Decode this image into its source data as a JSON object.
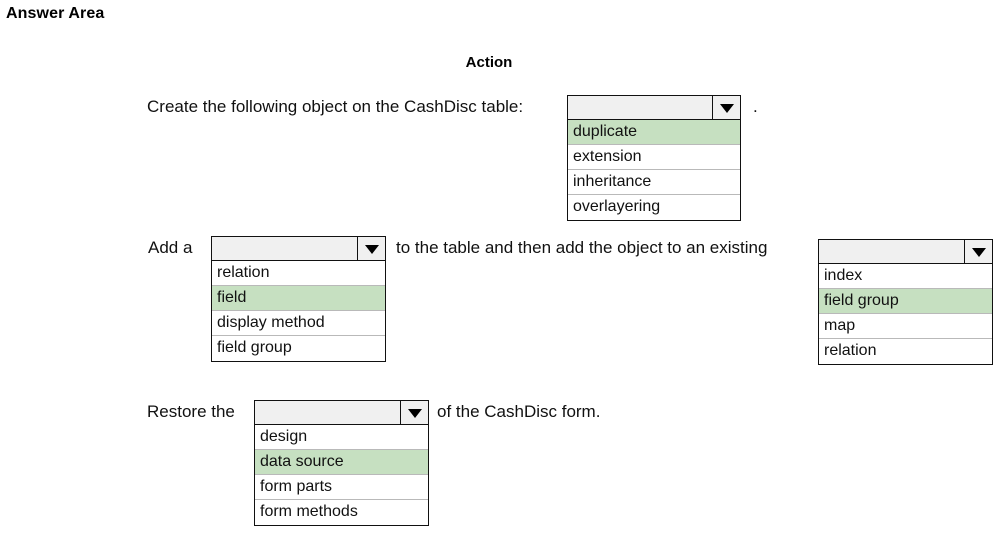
{
  "page": {
    "title": "Answer Area",
    "column_header": "Action"
  },
  "rows": [
    {
      "id": "row1",
      "text_before": "Create the following object on the CashDisc table:",
      "text_after": ".",
      "dropdown": {
        "name": "object-type",
        "value": "",
        "placeholder": "",
        "arrow_icon": "chevron-down-icon",
        "options": [
          "duplicate",
          "extension",
          "inheritance",
          "overlayering"
        ],
        "selected": "extension"
      }
    },
    {
      "id": "row2",
      "text_before": "Add a",
      "text_middle": "to the table and then add the object to an existing",
      "dropdown_left": {
        "name": "addition-type",
        "value": "",
        "placeholder": "",
        "arrow_icon": "chevron-down-icon",
        "options": [
          "relation",
          "field",
          "display method",
          "field group"
        ],
        "selected": "field"
      },
      "dropdown_right": {
        "name": "existing-object",
        "value": "",
        "placeholder": "",
        "arrow_icon": "chevron-down-icon",
        "options": [
          "index",
          "field group",
          "map",
          "relation"
        ],
        "selected": "field group"
      }
    },
    {
      "id": "row3",
      "text_before": "Restore the",
      "text_after": "of the CashDisc form.",
      "dropdown": {
        "name": "restore-target",
        "value": "",
        "placeholder": "",
        "arrow_icon": "chevron-down-icon",
        "options": [
          "design",
          "data source",
          "form parts",
          "form methods"
        ],
        "selected": "data source"
      }
    }
  ],
  "colors": {
    "highlight": "#c6e0c1",
    "control_face": "#f0f0f0",
    "border": "#111111",
    "option_divider": "#b9b9b9",
    "background": "#ffffff"
  }
}
